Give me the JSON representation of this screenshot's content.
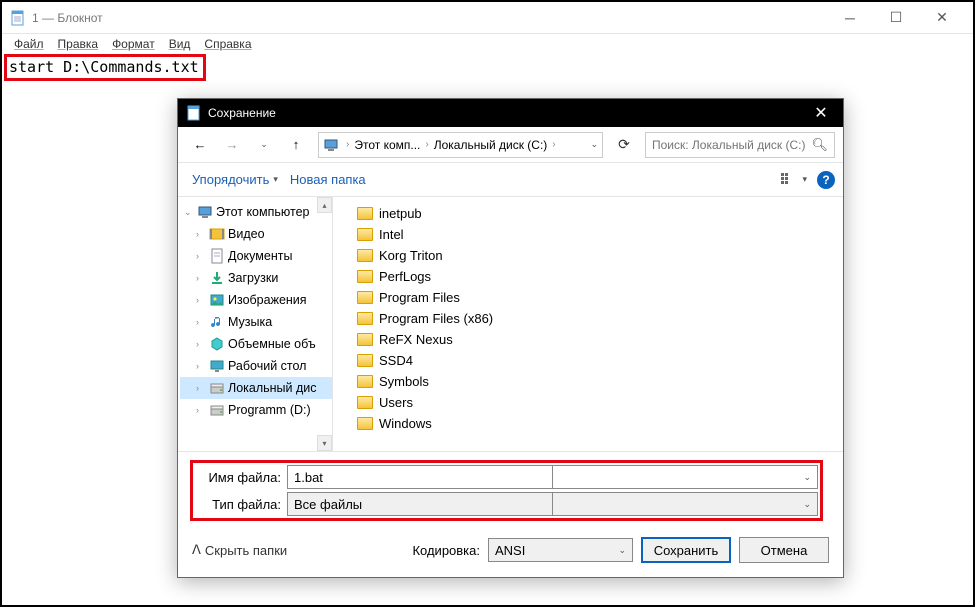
{
  "notepad": {
    "title": "1 — Блокнот",
    "menu": [
      "Файл",
      "Правка",
      "Формат",
      "Вид",
      "Справка"
    ],
    "content": "start D:\\Commands.txt"
  },
  "dialog": {
    "title": "Сохранение",
    "breadcrumb": [
      "Этот комп...",
      "Локальный диск (C:)"
    ],
    "search_placeholder": "Поиск: Локальный диск (C:)",
    "toolbar": {
      "organize": "Упорядочить",
      "new_folder": "Новая папка"
    },
    "tree": [
      {
        "label": "Этот компьютер",
        "level": 0,
        "chev": "⌄",
        "icon": "pc"
      },
      {
        "label": "Видео",
        "level": 1,
        "chev": "›",
        "icon": "video"
      },
      {
        "label": "Документы",
        "level": 1,
        "chev": "›",
        "icon": "doc"
      },
      {
        "label": "Загрузки",
        "level": 1,
        "chev": "›",
        "icon": "dl"
      },
      {
        "label": "Изображения",
        "level": 1,
        "chev": "›",
        "icon": "img"
      },
      {
        "label": "Музыка",
        "level": 1,
        "chev": "›",
        "icon": "music"
      },
      {
        "label": "Объемные объ",
        "level": 1,
        "chev": "›",
        "icon": "3d"
      },
      {
        "label": "Рабочий стол",
        "level": 1,
        "chev": "›",
        "icon": "desk"
      },
      {
        "label": "Локальный дис",
        "level": 1,
        "chev": "›",
        "icon": "disk",
        "selected": true
      },
      {
        "label": "Programm (D:)",
        "level": 1,
        "chev": "›",
        "icon": "disk"
      }
    ],
    "files": [
      "inetpub",
      "Intel",
      "Korg Triton",
      "PerfLogs",
      "Program Files",
      "Program Files (x86)",
      "ReFX Nexus",
      "SSD4",
      "Symbols",
      "Users",
      "Windows"
    ],
    "filename_label": "Имя файла:",
    "filename_value": "1.bat",
    "filetype_label": "Тип файла:",
    "filetype_value": "Все файлы",
    "hide_folders": "Скрыть папки",
    "encoding_label": "Кодировка:",
    "encoding_value": "ANSI",
    "save": "Сохранить",
    "cancel": "Отмена"
  }
}
